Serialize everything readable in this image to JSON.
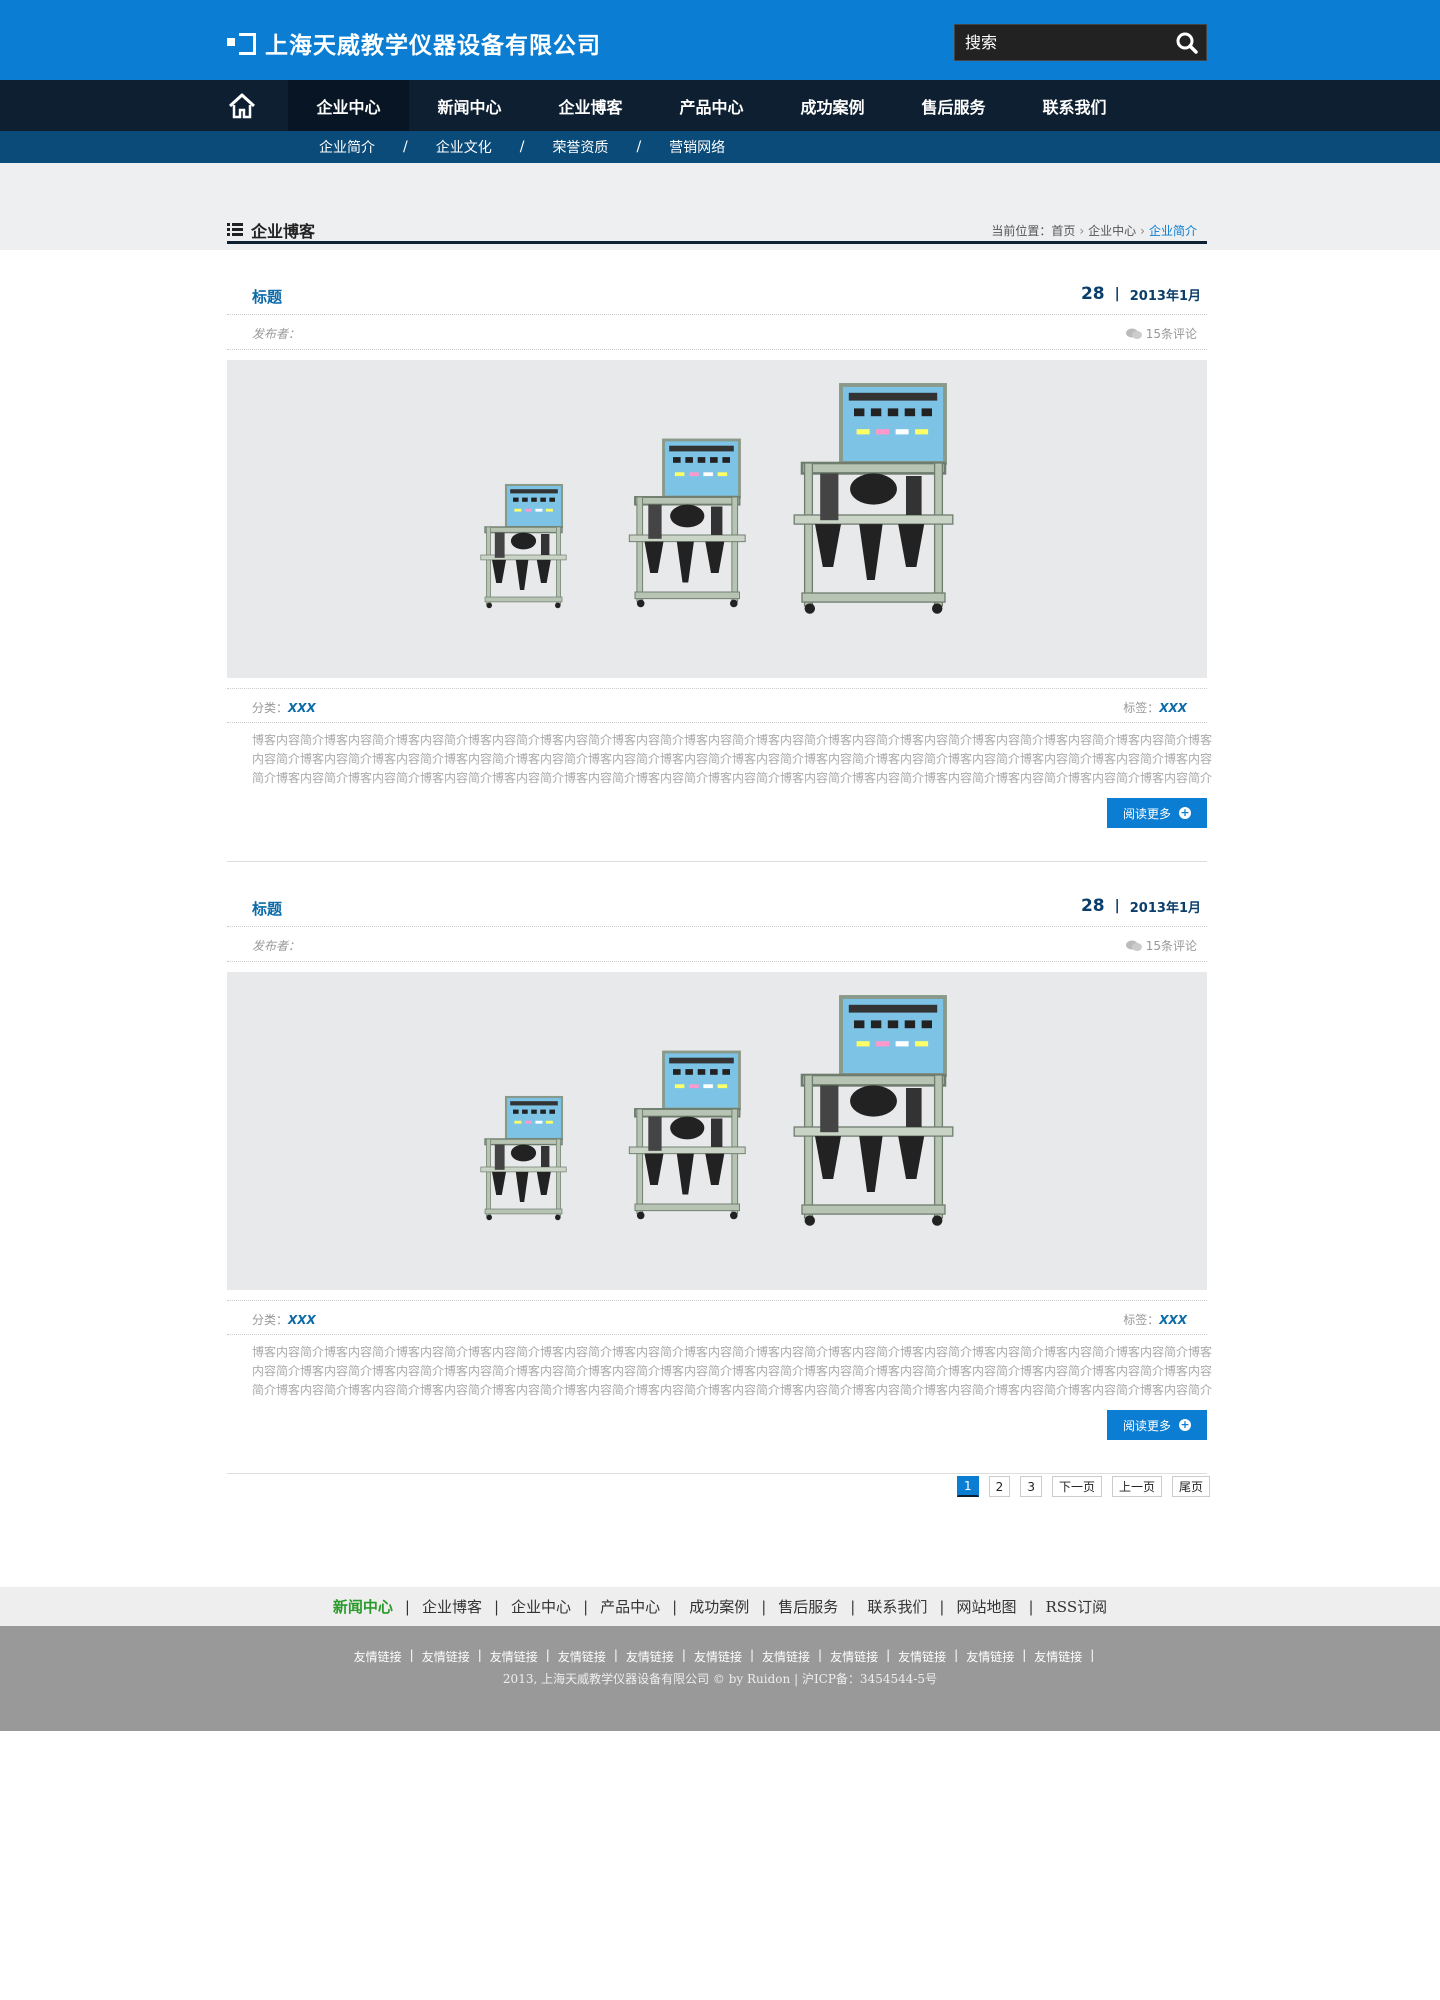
{
  "header": {
    "company_name": "上海天威教学仪器设备有限公司",
    "search_placeholder": "搜索"
  },
  "nav": {
    "items": [
      "企业中心",
      "新闻中心",
      "企业博客",
      "产品中心",
      "成功案例",
      "售后服务",
      "联系我们"
    ],
    "active": "企业中心"
  },
  "subnav": {
    "items": [
      "企业简介",
      "企业文化",
      "荣誉资质",
      "营销网络"
    ],
    "separator": "/"
  },
  "page": {
    "title": "企业博客",
    "breadcrumb_prefix": "当前位置：",
    "breadcrumb": [
      "首页",
      "企业中心",
      "企业简介"
    ]
  },
  "posts": [
    {
      "title": "标题",
      "day": "28",
      "year_month": "2013年1月",
      "author_label": "发布者：",
      "comments": "15条评论",
      "category_label": "分类：",
      "category": "XXX",
      "tag_label": "标签：",
      "tag": "XXX",
      "excerpt": "博客内容简介博客内容简介博客内容简介博客内容简介博客内容简介博客内容简介博客内容简介博客内容简介博客内容简介博客内容简介博客内容简介博客内容简介博客内容简介博客内容简介博客内容简介博客内容简介博客内容简介博客内容简介博客内容简介博客内容简介博客内容简介博客内容简介博客内容简介博客内容简介博客内容简介博客内容简介博客内容简介博客内容简介博客内容简介博客内容简介博客内容简介博客内容简介博客内容简介博客内容简介博客内容简介博客内容简介博客内容简介博客内容简介博客内容简介博客内容简介博客内容简介博客内容简介博客内容简介博客内容简介博客内容简介...",
      "read_more": "阅读更多"
    },
    {
      "title": "标题",
      "day": "28",
      "year_month": "2013年1月",
      "author_label": "发布者：",
      "comments": "15条评论",
      "category_label": "分类：",
      "category": "XXX",
      "tag_label": "标签：",
      "tag": "XXX",
      "excerpt": "博客内容简介博客内容简介博客内容简介博客内容简介博客内容简介博客内容简介博客内容简介博客内容简介博客内容简介博客内容简介博客内容简介博客内容简介博客内容简介博客内容简介博客内容简介博客内容简介博客内容简介博客内容简介博客内容简介博客内容简介博客内容简介博客内容简介博客内容简介博客内容简介博客内容简介博客内容简介博客内容简介博客内容简介博客内容简介博客内容简介博客内容简介博客内容简介博客内容简介博客内容简介博客内容简介博客内容简介博客内容简介博客内容简介博客内容简介博客内容简介博客内容简介博客内容简介博客内容简介博客内容简介博客内容简介...",
      "read_more": "阅读更多"
    }
  ],
  "pager": {
    "pages": [
      "1",
      "2",
      "3"
    ],
    "current": "1",
    "next": "下一页",
    "prev": "上一页",
    "last": "尾页"
  },
  "footer_nav": [
    "新闻中心",
    "企业博客",
    "企业中心",
    "产品中心",
    "成功案例",
    "售后服务",
    "联系我们",
    "网站地图",
    "RSS订阅"
  ],
  "footer": {
    "links": [
      "友情链接",
      "友情链接",
      "友情链接",
      "友情链接",
      "友情链接",
      "友情链接",
      "友情链接",
      "友情链接",
      "友情链接",
      "友情链接",
      "友情链接"
    ],
    "copyright": "2013, 上海天威教学仪器设备有限公司 © by Ruidon",
    "icp": "沪ICP备：3454544-5号"
  },
  "colors": {
    "header_blue": "#0b7ed3",
    "nav_dark": "#0d1f31",
    "subnav_blue": "#0a4b7a",
    "footer_gray": "#999999"
  },
  "icons": [
    "home-icon",
    "search-icon",
    "list-icon",
    "comment-icon",
    "plus-circle-icon",
    "chevron-right-icon"
  ]
}
